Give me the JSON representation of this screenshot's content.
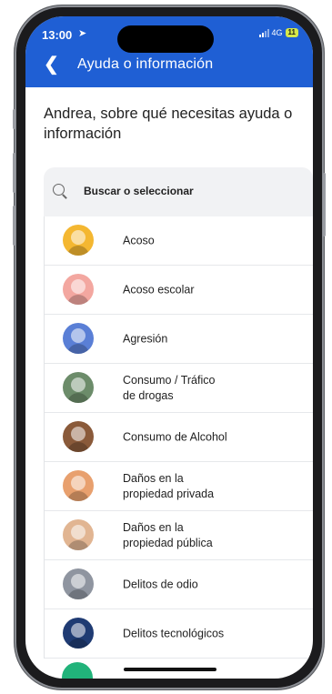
{
  "status": {
    "time": "13:00",
    "network": "4G",
    "battery": "11"
  },
  "header": {
    "title": "Ayuda o información"
  },
  "prompt": "Andrea, sobre qué necesitas ayuda o información",
  "search": {
    "placeholder": "Buscar o seleccionar"
  },
  "categories": [
    {
      "label": "Acoso",
      "color": "#f4b731"
    },
    {
      "label": "Acoso escolar",
      "color": "#f3a7a0"
    },
    {
      "label": "Agresión",
      "color": "#5a7fd6"
    },
    {
      "label": "Consumo / Tráfico\nde drogas",
      "color": "#6c8c6a"
    },
    {
      "label": "Consumo de Alcohol",
      "color": "#8a5a3a"
    },
    {
      "label": "Daños en la\npropiedad privada",
      "color": "#e8a06e"
    },
    {
      "label": "Daños en la\npropiedad pública",
      "color": "#e1b592"
    },
    {
      "label": "Delitos de odio",
      "color": "#8f95a0"
    },
    {
      "label": "Delitos tecnológicos",
      "color": "#1f3b73"
    }
  ]
}
